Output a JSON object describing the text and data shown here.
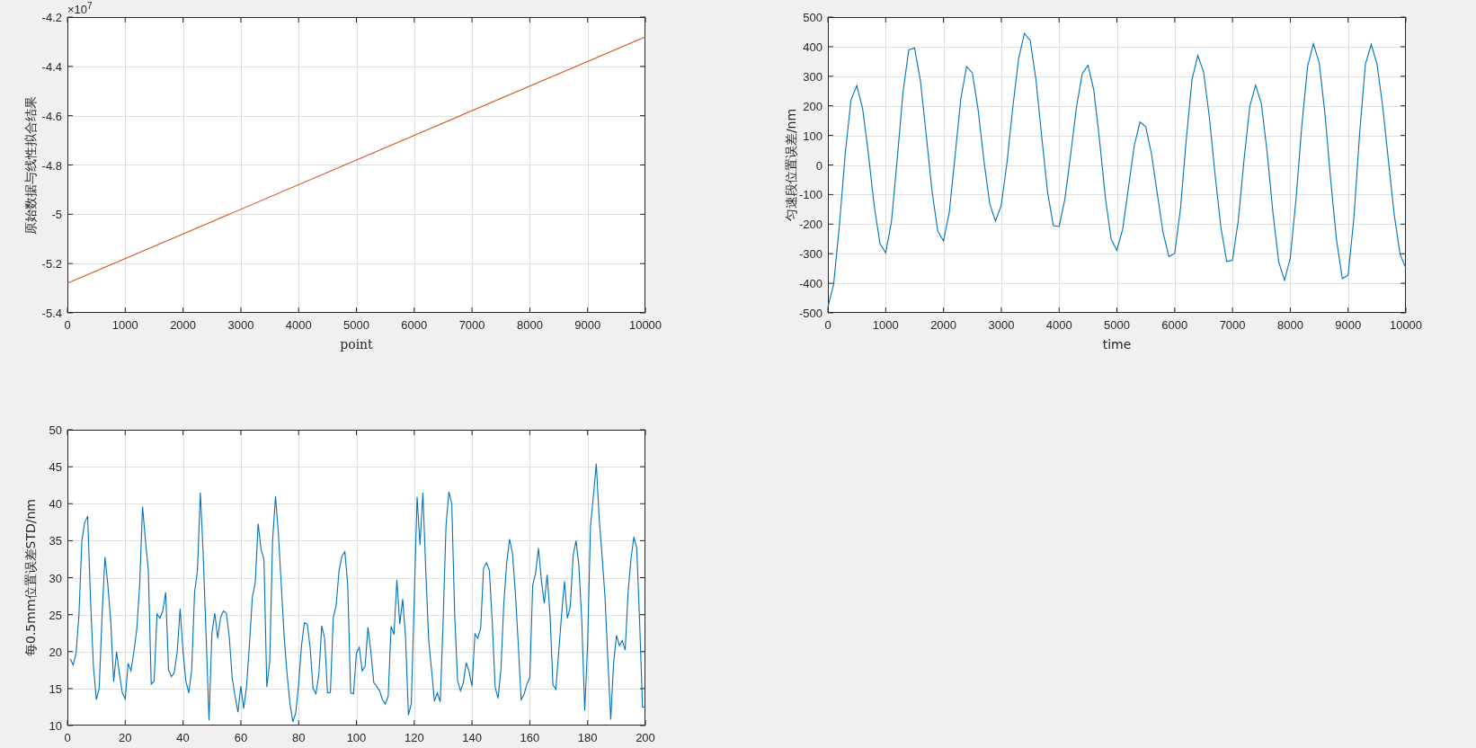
{
  "axes_1": {
    "exponent_label": "×10$^{7}$",
    "chart_data": {
      "type": "line",
      "xlabel": "point",
      "ylabel": "原始数据与线性拟合结果",
      "grid": true,
      "x": [
        0,
        10000
      ],
      "series": [
        {
          "color": "#d95319",
          "values": [
            -5.28,
            -4.28
          ]
        }
      ],
      "xlim": [
        0,
        10000
      ],
      "ylim": [
        -5.4,
        -4.2
      ],
      "xticks": [
        0,
        1000,
        2000,
        3000,
        4000,
        5000,
        6000,
        7000,
        8000,
        9000,
        10000
      ],
      "yticks": [
        -5.4,
        -5.2,
        -5,
        -4.8,
        -4.6,
        -4.4,
        -4.2
      ]
    }
  },
  "axes_2": {
    "chart_data": {
      "type": "line",
      "xlabel": "time",
      "ylabel": "匀速段位置误差/nm",
      "grid": true,
      "x": [
        0,
        100,
        200,
        300,
        400,
        500,
        600,
        700,
        800,
        900,
        1000,
        1100,
        1200,
        1300,
        1400,
        1500,
        1600,
        1700,
        1800,
        1900,
        2000,
        2100,
        2200,
        2300,
        2400,
        2500,
        2600,
        2700,
        2800,
        2900,
        3000,
        3100,
        3200,
        3300,
        3400,
        3500,
        3600,
        3700,
        3800,
        3900,
        4000,
        4100,
        4200,
        4300,
        4400,
        4500,
        4600,
        4700,
        4800,
        4900,
        5000,
        5100,
        5200,
        5300,
        5400,
        5500,
        5600,
        5700,
        5800,
        5900,
        6000,
        6100,
        6200,
        6300,
        6400,
        6500,
        6600,
        6700,
        6800,
        6900,
        7000,
        7100,
        7200,
        7300,
        7400,
        7500,
        7600,
        7700,
        7800,
        7900,
        8000,
        8100,
        8200,
        8300,
        8400,
        8500,
        8600,
        8700,
        8800,
        8900,
        9000,
        9100,
        9200,
        9300,
        9400,
        9500,
        9600,
        9700,
        9800,
        9900,
        10000
      ],
      "series": [
        {
          "color": "#0072bd",
          "values": [
            -480,
            -403,
            -202,
            38,
            220,
            268,
            192,
            39,
            -136,
            -265,
            -297,
            -191,
            20,
            247,
            390,
            395,
            286,
            104,
            -86,
            -223,
            -257,
            -161,
            30,
            224,
            333,
            311,
            186,
            14,
            -132,
            -190,
            -136,
            10,
            196,
            360,
            445,
            421,
            288,
            95,
            -91,
            -205,
            -208,
            -116,
            35,
            194,
            309,
            337,
            254,
            84,
            -109,
            -251,
            -288,
            -217,
            -77,
            65,
            145,
            129,
            36,
            -99,
            -229,
            -310,
            -299,
            -148,
            85,
            289,
            370,
            314,
            162,
            -35,
            -212,
            -326,
            -322,
            -188,
            18,
            199,
            270,
            207,
            42,
            -162,
            -327,
            -390,
            -314,
            -114,
            134,
            334,
            410,
            346,
            173,
            -53,
            -254,
            -384,
            -373,
            -180,
            107,
            341,
            408,
            342,
            196,
            11,
            -171,
            -302,
            -350
          ]
        }
      ],
      "xlim": [
        0,
        10000
      ],
      "ylim": [
        -500,
        500
      ],
      "xticks": [
        0,
        1000,
        2000,
        3000,
        4000,
        5000,
        6000,
        7000,
        8000,
        9000,
        10000
      ],
      "yticks": [
        -500,
        -400,
        -300,
        -200,
        -100,
        0,
        100,
        200,
        300,
        400,
        500
      ]
    }
  },
  "axes_3": {
    "chart_data": {
      "type": "line",
      "ylabel": "每0.5mm位置误差STD/nm",
      "grid": true,
      "x": [
        1,
        2,
        3,
        4,
        5,
        6,
        7,
        8,
        9,
        10,
        11,
        12,
        13,
        14,
        15,
        16,
        17,
        18,
        19,
        20,
        21,
        22,
        23,
        24,
        25,
        26,
        27,
        28,
        29,
        30,
        31,
        32,
        33,
        34,
        35,
        36,
        37,
        38,
        39,
        40,
        41,
        42,
        43,
        44,
        45,
        46,
        47,
        48,
        49,
        50,
        51,
        52,
        53,
        54,
        55,
        56,
        57,
        58,
        59,
        60,
        61,
        62,
        63,
        64,
        65,
        66,
        67,
        68,
        69,
        70,
        71,
        72,
        73,
        74,
        75,
        76,
        77,
        78,
        79,
        80,
        81,
        82,
        83,
        84,
        85,
        86,
        87,
        88,
        89,
        90,
        91,
        92,
        93,
        94,
        95,
        96,
        97,
        98,
        99,
        100,
        101,
        102,
        103,
        104,
        105,
        106,
        107,
        108,
        109,
        110,
        111,
        112,
        113,
        114,
        115,
        116,
        117,
        118,
        119,
        120,
        121,
        122,
        123,
        124,
        125,
        126,
        127,
        128,
        129,
        130,
        131,
        132,
        133,
        134,
        135,
        136,
        137,
        138,
        139,
        140,
        141,
        142,
        143,
        144,
        145,
        146,
        147,
        148,
        149,
        150,
        151,
        152,
        153,
        154,
        155,
        156,
        157,
        158,
        159,
        160,
        161,
        162,
        163,
        164,
        165,
        166,
        167,
        168,
        169,
        170,
        171,
        172,
        173,
        174,
        175,
        176,
        177,
        178,
        179,
        180,
        181,
        182,
        183,
        184,
        185,
        186,
        187,
        188,
        189,
        190,
        191,
        192,
        193,
        194,
        195,
        196,
        197,
        198,
        199,
        200
      ],
      "series": [
        {
          "color": "#0072bd",
          "values": [
            19,
            18.2,
            19.8,
            25,
            35,
            37.5,
            38.3,
            27,
            18,
            13.5,
            15,
            25,
            32.8,
            29,
            24,
            15.9,
            20,
            17,
            14.4,
            13.6,
            18.4,
            17.4,
            20,
            23,
            29,
            39.6,
            35,
            31,
            15.6,
            16,
            25.1,
            24.5,
            25.5,
            28,
            17.5,
            16.6,
            17.2,
            20,
            25.8,
            20,
            16,
            14.4,
            17.5,
            28,
            31,
            41.5,
            33,
            22,
            10.7,
            22.5,
            25.2,
            21.8,
            24.6,
            25.5,
            25.2,
            22,
            16.5,
            14,
            11.8,
            15.3,
            12.3,
            15.3,
            21,
            27.4,
            29.3,
            37.3,
            33.8,
            32.5,
            15.2,
            18.6,
            35,
            41,
            36,
            29,
            22,
            17,
            13,
            10.5,
            11.7,
            15.6,
            20.8,
            23.9,
            23.7,
            20.5,
            15,
            14.3,
            16.9,
            23.5,
            21.8,
            14.4,
            14.5,
            24.6,
            26.3,
            31,
            32.9,
            33.5,
            29,
            14.4,
            14.3,
            19.8,
            20.6,
            17.4,
            18,
            23.3,
            20,
            15.8,
            15.3,
            14.7,
            13.5,
            12.9,
            14,
            23.4,
            22.3,
            29.7,
            23.7,
            27.1,
            22,
            11.4,
            13,
            27,
            40.9,
            34.4,
            41.5,
            31,
            21.6,
            17.5,
            13.3,
            14.4,
            13.2,
            24,
            37,
            41.6,
            40,
            25,
            16.1,
            14.7,
            15.8,
            18.5,
            17.3,
            15.3,
            22.4,
            21.8,
            23.2,
            31.3,
            32,
            31,
            24,
            15.2,
            13.7,
            17.5,
            26.5,
            32,
            35.2,
            33.3,
            28,
            21,
            13.5,
            14.2,
            15.6,
            16.5,
            29,
            30.6,
            34,
            29.6,
            26.5,
            30.4,
            25,
            15.5,
            14.9,
            20,
            25,
            29.5,
            24.5,
            26.1,
            33,
            35,
            31.5,
            24,
            12,
            21,
            37,
            41,
            45.4,
            38,
            33,
            27.5,
            19,
            10.8,
            18.5,
            22.2,
            20.8,
            21.5,
            20.2,
            28,
            32.5,
            35.5,
            34,
            24,
            12.5,
            12.5
          ]
        }
      ],
      "xlim": [
        0,
        200
      ],
      "ylim": [
        10,
        50
      ],
      "xticks": [
        0,
        20,
        40,
        60,
        80,
        100,
        120,
        140,
        160,
        180,
        200
      ],
      "yticks": [
        10,
        15,
        20,
        25,
        30,
        35,
        40,
        45,
        50
      ]
    }
  }
}
